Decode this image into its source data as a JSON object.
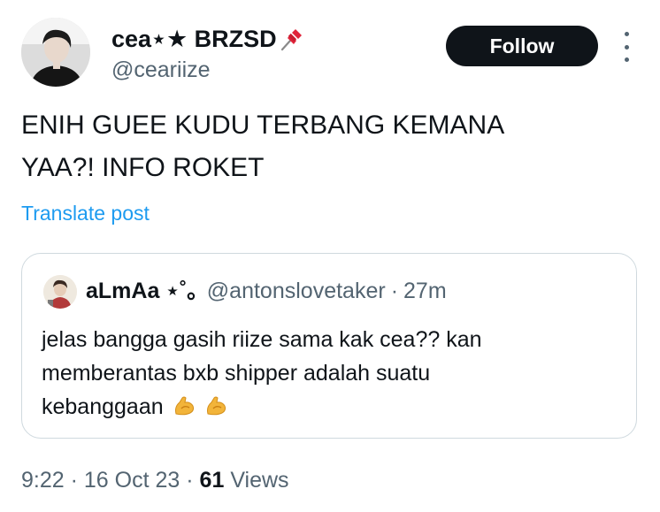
{
  "author": {
    "display_name": "cea⋆★ BRZSD",
    "handle": "@ceariize",
    "pin_icon": "pushpin-icon"
  },
  "follow_label": "Follow",
  "more_icon": "more-vertical-icon",
  "tweet": {
    "line1": "ENIH GUEE KUDU TERBANG KEMANA",
    "line2": "YAA?! INFO ROKET"
  },
  "translate_label": "Translate post",
  "quote": {
    "display_name": "aLmAa ⋆˚｡",
    "handle": "@antonslovetaker",
    "sep": "·",
    "time": "27m",
    "line1": "jelas bangga gasih riize sama kak cea?? kan",
    "line2": "memberantas bxb shipper adalah suatu",
    "line3": "kebanggaan",
    "emoji_icon": "flexed-biceps-icon"
  },
  "meta": {
    "time": "9:22",
    "sep1": "·",
    "date": "16 Oct 23",
    "sep2": "·",
    "views_count": "61",
    "views_label": "Views"
  },
  "colors": {
    "text": "#0f1419",
    "secondary": "#536471",
    "link": "#1d9bf0",
    "border": "#cfd9de",
    "button_bg": "#0f1419"
  }
}
